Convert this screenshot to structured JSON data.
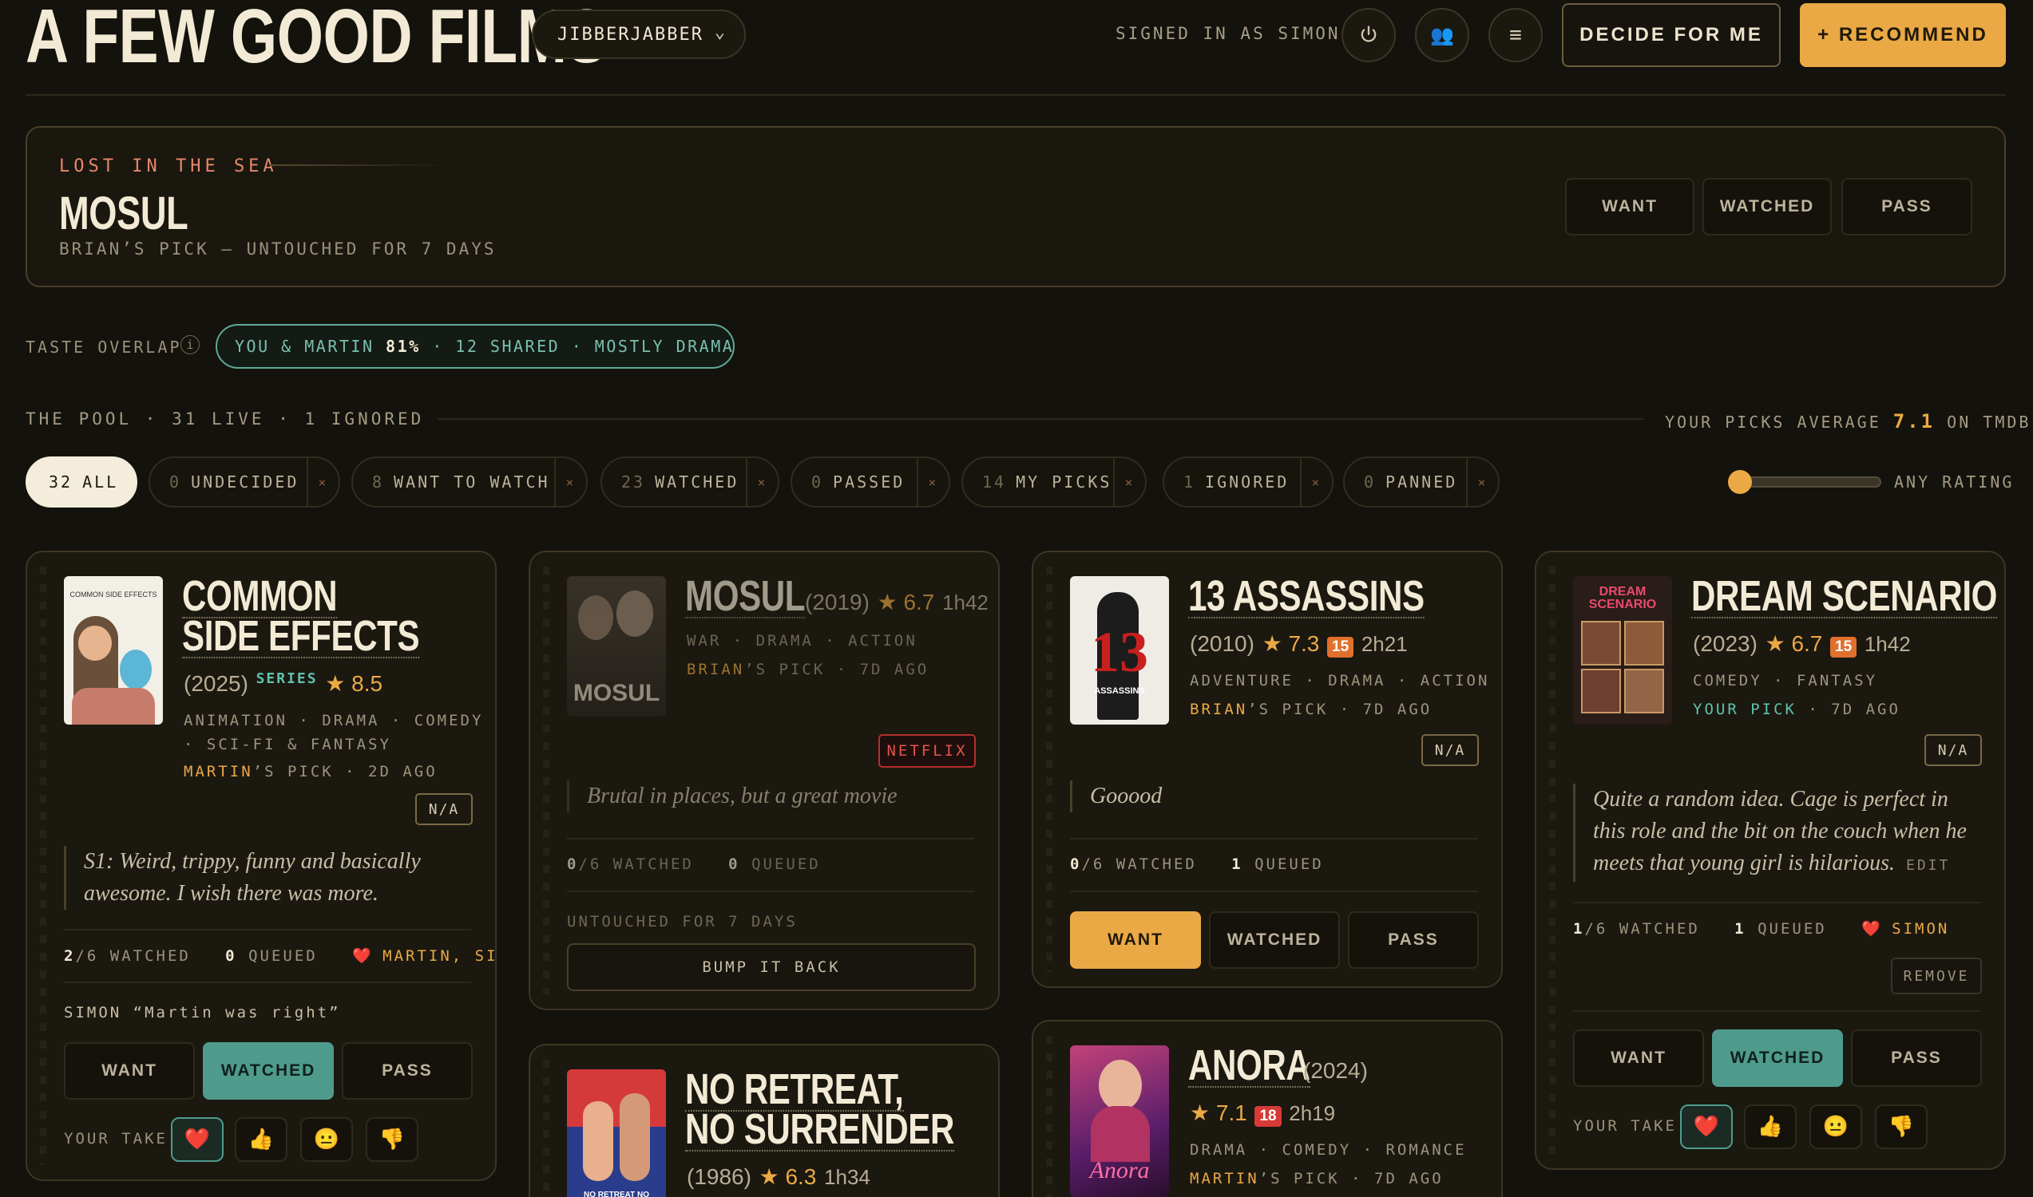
{
  "header": {
    "site_title": "A FEW GOOD FILMS",
    "group": "JIBBERJABBER",
    "signed_in": "SIGNED IN AS SIMON",
    "decide_label": "DECIDE FOR ME",
    "recommend_label": "+ RECOMMEND"
  },
  "lost": {
    "kicker": "LOST IN THE SEA",
    "title": "MOSUL",
    "subtitle": "BRIAN’S PICK — UNTOUCHED FOR 7 DAYS",
    "buttons": [
      "WANT",
      "WATCHED",
      "PASS"
    ]
  },
  "taste": {
    "label": "TASTE OVERLAP",
    "info": "i",
    "pill_prefix": "YOU & MARTIN ",
    "pill_pct": "81%",
    "pill_suffix": " · 12 SHARED · MOSTLY DRAMA"
  },
  "pool": {
    "label": "THE POOL · 31 LIVE · 1 IGNORED",
    "avg_prefix": "YOUR PICKS AVERAGE ",
    "avg_value": "7.1",
    "avg_suffix": " ON TMDB",
    "any_rating": "ANY RATING",
    "rating_filter_fraction": 0.0,
    "filters": [
      {
        "count": "32",
        "label": "ALL"
      },
      {
        "count": "0",
        "label": "UNDECIDED"
      },
      {
        "count": "8",
        "label": "WANT TO WATCH"
      },
      {
        "count": "23",
        "label": "WATCHED"
      },
      {
        "count": "0",
        "label": "PASSED"
      },
      {
        "count": "14",
        "label": "MY PICKS"
      },
      {
        "count": "1",
        "label": "IGNORED"
      },
      {
        "count": "0",
        "label": "PANNED"
      }
    ],
    "filter_close": "×"
  },
  "cards": {
    "cse": {
      "title1": "COMMON",
      "title2": "SIDE EFFECTS",
      "poster_text": "COMMON SIDE EFFECTS",
      "year": "(2025)",
      "series": "SERIES",
      "rating": "★ 8.5",
      "genres1": "ANIMATION · DRAMA · COMEDY",
      "genres2": "· SCI-FI & FANTASY",
      "picker": "MARTIN",
      "picker_rest": "’S PICK · 2D AGO",
      "badge": "N/A",
      "quote": "S1: Weird, trippy, funny and basically awesome. I wish there was more.",
      "watched_n": "2",
      "watched_rest": "/6 WATCHED",
      "queued_n": "0",
      "queued_rest": "QUEUED",
      "heart": "❤️",
      "lovers": "MARTIN, SIMON",
      "comment": "SIMON “Martin was right”",
      "buttons": [
        "WANT",
        "WATCHED",
        "PASS"
      ],
      "take_label": "YOUR TAKE",
      "takes": [
        "❤️",
        "👍",
        "😐",
        "👎"
      ]
    },
    "mosul": {
      "title": "MOSUL",
      "year": "(2019)",
      "rating": "★ 6.7",
      "runtime": "1h42",
      "genres": "WAR · DRAMA · ACTION",
      "picker": "BRIAN",
      "picker_rest": "’S PICK · 7D AGO",
      "poster_text": "MOSUL",
      "badge": "NETFLIX",
      "quote": "Brutal in places, but a great movie",
      "watched_n": "0",
      "watched_rest": "/6 WATCHED",
      "queued_n": "0",
      "queued_rest": "QUEUED",
      "untouched": "UNTOUCHED FOR 7 DAYS",
      "bump": "BUMP IT BACK"
    },
    "assassins": {
      "title": "13 ASSASSINS",
      "year": "(2010)",
      "rating": "★ 7.3",
      "cert": "15",
      "runtime": "2h21",
      "genres": "ADVENTURE · DRAMA · ACTION",
      "picker": "BRIAN",
      "picker_rest": "’S PICK · 7D AGO",
      "poster_big": "13",
      "poster_text": "ASSASSINS",
      "badge": "N/A",
      "quote": "Gooood",
      "watched_n": "0",
      "watched_rest": "/6 WATCHED",
      "queued_n": "1",
      "queued_rest": "QUEUED",
      "buttons": [
        "WANT",
        "WATCHED",
        "PASS"
      ]
    },
    "dream": {
      "title": "DREAM SCENARIO",
      "year": "(2023)",
      "rating": "★ 6.7",
      "cert": "15",
      "runtime": "1h42",
      "genres": "COMEDY · FANTASY",
      "picker": "YOUR PICK",
      "picker_rest": " · 7D AGO",
      "poster_text": "DREAM SCENARIO",
      "badge": "N/A",
      "quote": "Quite a random idea. Cage is perfect in this role and the bit on the couch when he meets that young girl is hilarious.",
      "edit": "EDIT",
      "watched_n": "1",
      "watched_rest": "/6 WATCHED",
      "queued_n": "1",
      "queued_rest": "QUEUED",
      "heart": "❤️",
      "lovers": "SIMON",
      "remove": "REMOVE",
      "buttons": [
        "WANT",
        "WATCHED",
        "PASS"
      ],
      "take_label": "YOUR TAKE",
      "takes": [
        "❤️",
        "👍",
        "😐",
        "👎"
      ]
    },
    "noretreat": {
      "title1": "NO RETREAT,",
      "title2": "NO SURRENDER",
      "year": "(1986)",
      "rating": "★ 6.3",
      "runtime": "1h34",
      "poster_text": "NO RETREAT NO SURRENDER"
    },
    "anora": {
      "title": "ANORA",
      "year": "(2024)",
      "rating": "★ 7.1",
      "cert": "18",
      "runtime": "2h19",
      "genres": "DRAMA · COMEDY · ROMANCE",
      "picker": "MARTIN",
      "picker_rest": "’S PICK · 7D AGO",
      "poster_text": "Anora"
    }
  }
}
